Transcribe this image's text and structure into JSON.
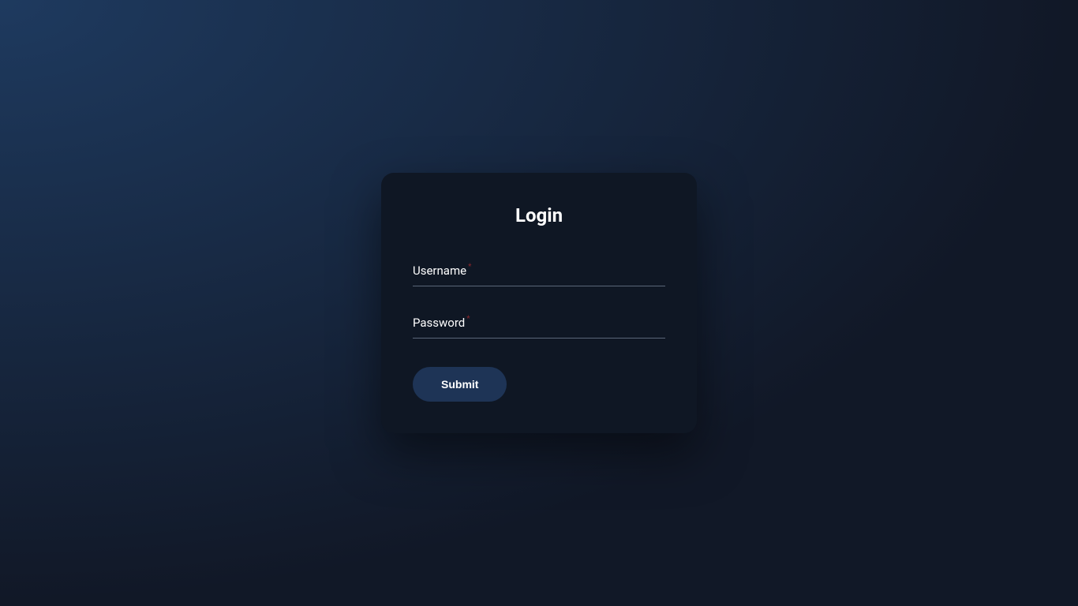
{
  "login": {
    "title": "Login",
    "username_label": "Username",
    "password_label": "Password",
    "required_mark": "*",
    "submit_label": "Submit"
  }
}
